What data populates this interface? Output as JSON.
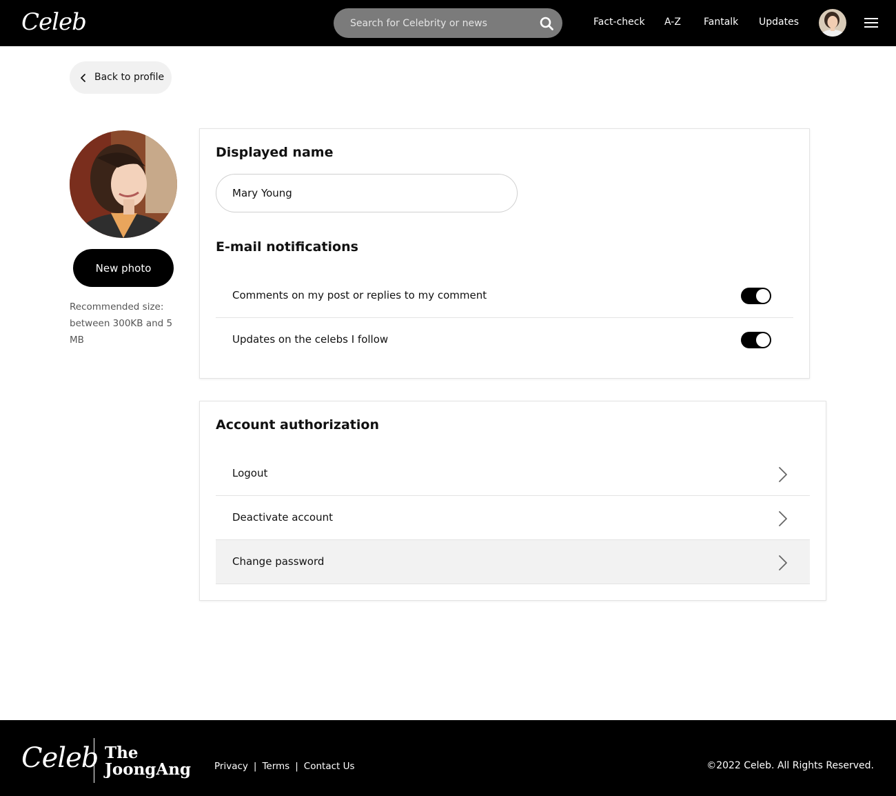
{
  "header": {
    "logo": "Celeb",
    "search_placeholder": "Search for Celebrity or news",
    "nav": [
      "Fact-check",
      "A-Z",
      "Fantalk",
      "Updates"
    ]
  },
  "back": {
    "label": "Back to profile"
  },
  "profile": {
    "new_photo_label": "New photo",
    "hint": "Recommended size: between 300KB and 5 MB"
  },
  "settings": {
    "displayed_name_title": "Displayed name",
    "displayed_name_value": "Mary Young",
    "email_title": "E-mail notifications",
    "notifications": [
      {
        "label": "Comments on my post or replies to my comment",
        "enabled": true
      },
      {
        "label": "Updates on the celebs I follow",
        "enabled": true
      }
    ]
  },
  "account": {
    "title": "Account authorization",
    "items": [
      "Logout",
      "Deactivate account",
      "Change password"
    ]
  },
  "footer": {
    "logo": "Celeb",
    "partner_line1": "The",
    "partner_line2": "JoongAng",
    "links": [
      "Privacy",
      "Terms",
      "Contact Us"
    ],
    "copyright": "©2022 Celeb. All Rights Reserved."
  }
}
